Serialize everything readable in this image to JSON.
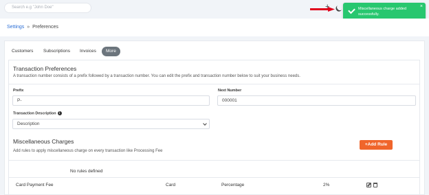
{
  "search": {
    "placeholder": "Search e.g \"John Doe\""
  },
  "toast": {
    "message": "Miscellaneous charge added successfully.",
    "close": "×",
    "color": "#28c76f"
  },
  "header": {
    "plus": "+"
  },
  "breadcrumb": {
    "root": "Settings",
    "separator": "»",
    "current": "Preferences"
  },
  "tabs": [
    {
      "label": "Customers"
    },
    {
      "label": "Subscriptions"
    },
    {
      "label": "Invoices"
    },
    {
      "label": "More",
      "active": true
    }
  ],
  "transaction": {
    "title": "Transaction Preferences",
    "description": "A transaction number consists of a prefix followed by a transaction number. You can edit the prefix and transaction number below to suit your business needs.",
    "prefix_label": "Prefix",
    "prefix_value": "P-",
    "next_number_label": "Next Number",
    "next_number_value": "000001",
    "desc_label": "Transaction Description",
    "desc_info": "i",
    "desc_value": "Description"
  },
  "misc": {
    "title": "Miscellaneous Charges",
    "description": "Add rules to apply miscellaneous charge on every transaction like Processing Fee",
    "add_button": "+Add Rule",
    "add_button_color": "#f0652b",
    "no_rules": "No rules defined",
    "row": {
      "name": "Card Payment Fee",
      "method": "Card",
      "type": "Percentage",
      "value": "2%"
    }
  }
}
